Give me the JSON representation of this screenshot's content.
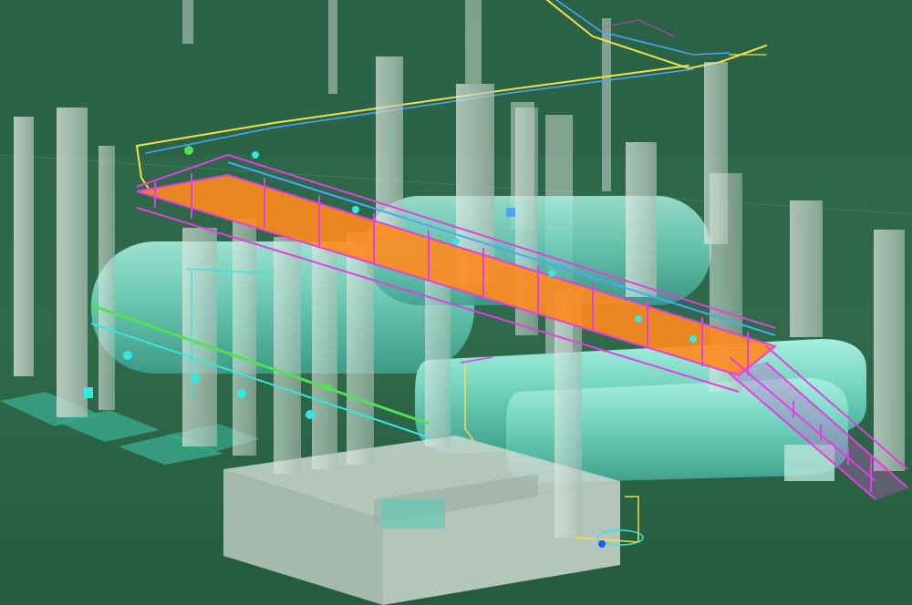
{
  "scene": {
    "kind": "3d-plant-model-viewport",
    "colors": {
      "background": "#2f6a4a",
      "background_dark": "#245a3c",
      "column": "#c9d8cf",
      "tank": "#7fd6c3",
      "platform_structure": "#e040e0",
      "platform_deck": "#ff8a1e",
      "pipe_yellow": "#f2e04a",
      "pipe_blue": "#4aa6ff",
      "pipe_green": "#53e053",
      "pipe_cyan": "#37e6df",
      "concrete_pit": "#b7c6bf"
    },
    "objects": [
      "concrete-columns",
      "horizontal-storage-tanks",
      "elevated-walkway-platform",
      "access-stair",
      "pipe-rack-lines",
      "valves-and-instruments",
      "ground-slabs",
      "concrete-pit"
    ]
  }
}
